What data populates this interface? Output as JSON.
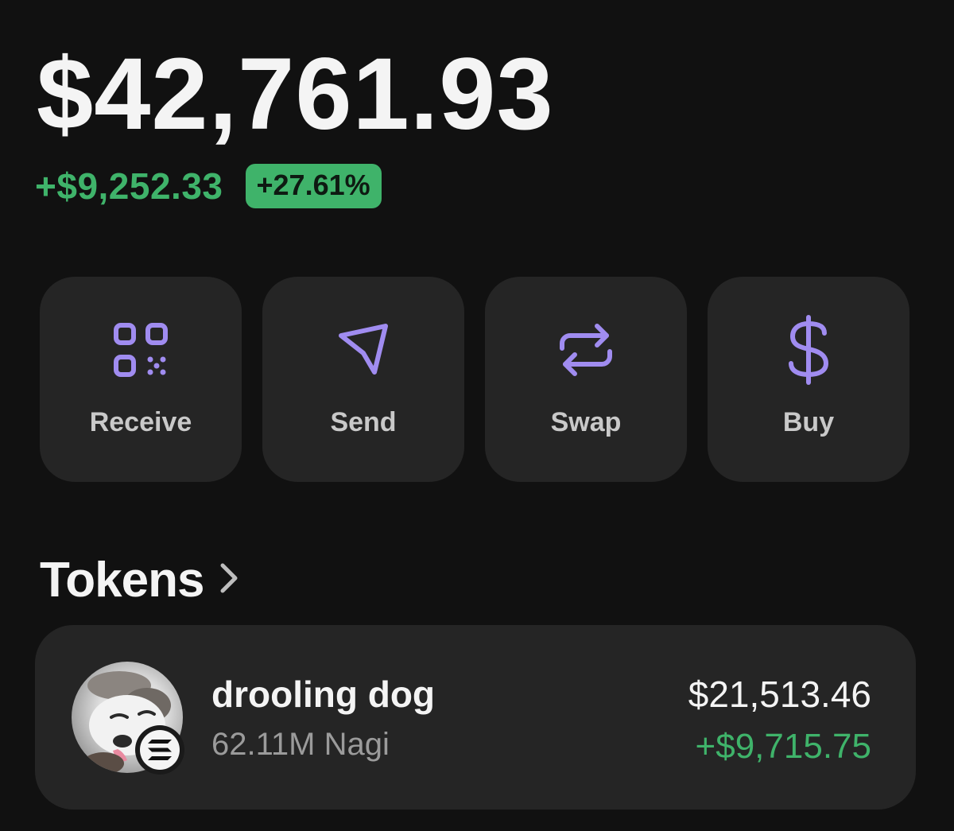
{
  "balance": {
    "total": "$42,761.93",
    "change_amount": "+$9,252.33",
    "change_percent": "+27.61%"
  },
  "colors": {
    "accent": "#a08cf0",
    "positive": "#3fb36a",
    "card": "#252525",
    "background": "#111111"
  },
  "actions": [
    {
      "label": "Receive",
      "icon": "qr-code-icon"
    },
    {
      "label": "Send",
      "icon": "send-icon"
    },
    {
      "label": "Swap",
      "icon": "swap-icon"
    },
    {
      "label": "Buy",
      "icon": "dollar-icon"
    }
  ],
  "tokens_section": {
    "title": "Tokens"
  },
  "tokens": [
    {
      "name": "drooling dog",
      "quantity": "62.11M Nagi",
      "value": "$21,513.46",
      "change": "+$9,715.75",
      "avatar": "dog-avatar",
      "chain_icon": "solana-icon"
    }
  ]
}
